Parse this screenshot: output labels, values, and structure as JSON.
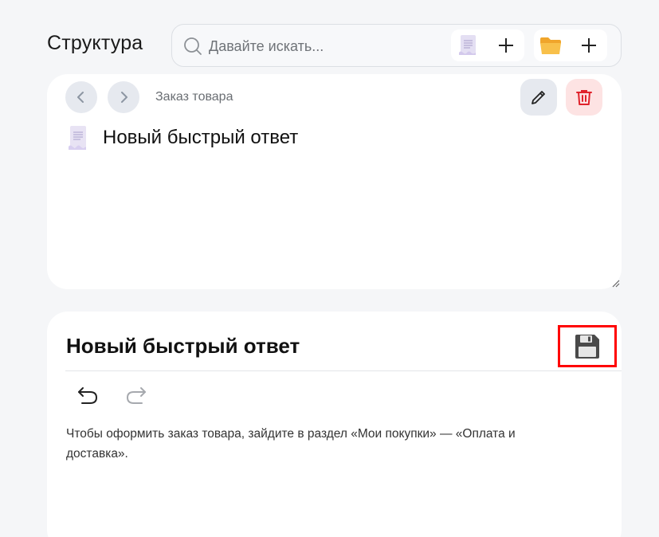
{
  "header": {
    "title": "Структура",
    "search": {
      "placeholder": "Давайте искать...",
      "value": ""
    },
    "add_document_icon": "document-icon",
    "add_folder_icon": "folder-icon"
  },
  "top_card": {
    "breadcrumb": "Заказ товара",
    "document_title": "Новый быстрый ответ"
  },
  "editor": {
    "title": "Новый быстрый ответ",
    "body_text": "Чтобы оформить заказ товара, зайдите в раздел «Мои покупки» — «Оплата и доставка»."
  },
  "colors": {
    "delete_accent": "#e0222b",
    "highlight_border": "#ff0000",
    "folder": "#f6b73c",
    "document": "#d9d2ee"
  }
}
